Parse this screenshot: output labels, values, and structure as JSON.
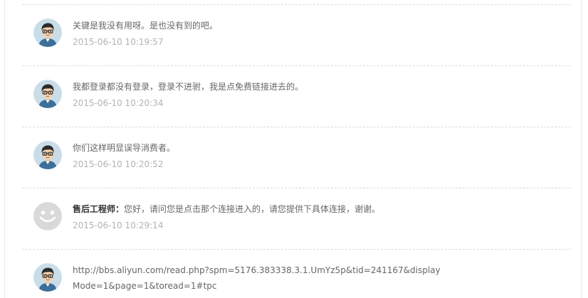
{
  "comments": [
    {
      "text": "关键是我没有用呀。是也没有到的吧。",
      "time": "2015-06-10 10:19:57"
    },
    {
      "text": "我都登录都没有登录，登录不进驸，我是点免费链接进去的。",
      "time": "2015-06-10 10:20:34"
    },
    {
      "text": "你们这样明显误导消费者。",
      "time": "2015-06-10 10:20:52"
    },
    {
      "author": "售后工程师：",
      "text": "您好，请问您是点击那个连接进入的，请您提供下具体连接，谢谢。",
      "time": "2015-06-10 10:29:14"
    },
    {
      "text": "http://bbs.aliyun.com/read.php?spm=5176.383338.3.1.UmYz5p&tid=241167&displayMode=1&page=1&toread=1#tpc"
    }
  ],
  "icons": {
    "user_avatar": "user-avatar-icon",
    "support_avatar": "smiley-avatar-icon"
  },
  "colors": {
    "message_text": "#666666",
    "timestamp": "#b3b3b3",
    "author_text": "#333333",
    "separator": "#d9d9d9"
  }
}
